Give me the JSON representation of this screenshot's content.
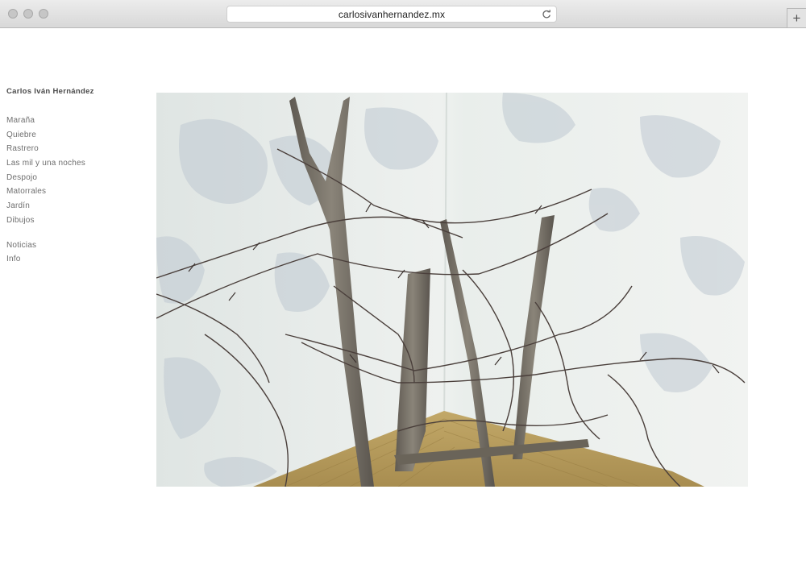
{
  "browser": {
    "url": "carlosivanhernandez.mx",
    "reload_icon": "reload-icon",
    "new_tab_label": "+"
  },
  "site": {
    "title": "Carlos Iván Hernández"
  },
  "nav": {
    "items": [
      {
        "label": "Maraña"
      },
      {
        "label": "Quiebre"
      },
      {
        "label": "Rastrero"
      },
      {
        "label": "Las mil y una noches"
      },
      {
        "label": "Despojo"
      },
      {
        "label": "Matorrales"
      },
      {
        "label": "Jardín"
      },
      {
        "label": "Dibujos"
      }
    ],
    "secondary": [
      {
        "label": "Noticias"
      },
      {
        "label": "Info"
      }
    ]
  },
  "colors": {
    "wall": "#e6ebe8",
    "floor": "#b39a5a",
    "wood": "#7d766c",
    "wire": "#4a3f3b",
    "text_title": "#4a4a4a",
    "text_nav": "#6e6e6e"
  }
}
